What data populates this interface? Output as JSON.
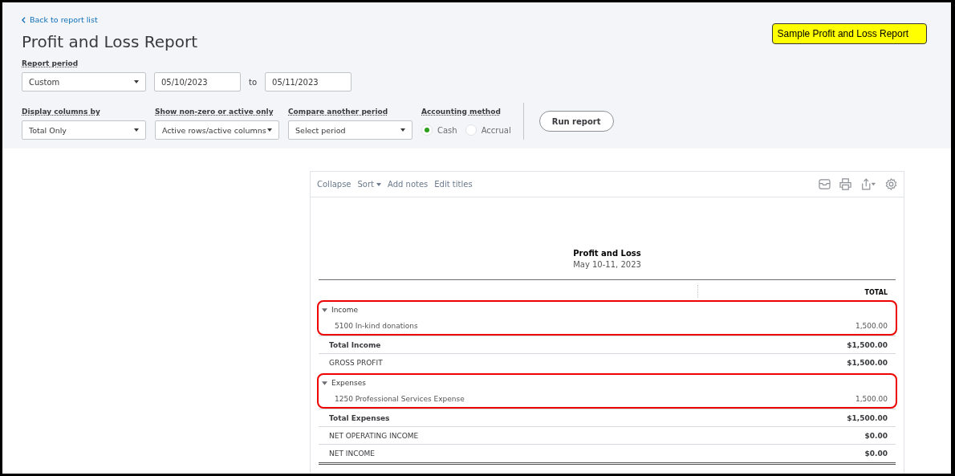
{
  "back_link": "Back to report list",
  "title": "Profit and Loss Report",
  "note": "Sample Profit and Loss Report",
  "report_period": {
    "label": "Report period",
    "preset": "Custom",
    "from": "05/10/2023",
    "to_label": "to",
    "to": "05/11/2023"
  },
  "filters": [
    {
      "label": "Display columns by",
      "value": "Total Only"
    },
    {
      "label": "Show non-zero or active only",
      "value": "Active rows/active columns"
    },
    {
      "label": "Compare another period",
      "placeholder": "Select period"
    }
  ],
  "accounting_method": {
    "label": "Accounting method",
    "options": [
      {
        "label": "Cash",
        "selected": true
      },
      {
        "label": "Accrual",
        "selected": false
      }
    ]
  },
  "run_button": "Run report",
  "toolbar": {
    "actions": [
      {
        "label": "Collapse",
        "dropdown": false
      },
      {
        "label": "Sort",
        "dropdown": true
      },
      {
        "label": "Add notes",
        "dropdown": false
      },
      {
        "label": "Edit titles",
        "dropdown": false
      }
    ]
  },
  "report": {
    "title": "Profit and Loss",
    "period": "May 10-11, 2023",
    "column": "TOTAL",
    "rows": [
      {
        "kind": "group",
        "label": "Income",
        "expanded": true,
        "highlighted": true,
        "children": [
          {
            "label": "5100 In-kind donations",
            "amount": "1,500.00"
          }
        ]
      },
      {
        "kind": "total",
        "label": "Total Income",
        "amount": "$1,500.00"
      },
      {
        "kind": "summary",
        "label": "GROSS PROFIT",
        "amount": "$1,500.00"
      },
      {
        "kind": "group",
        "label": "Expenses",
        "expanded": true,
        "highlighted": true,
        "children": [
          {
            "label": "1250 Professional Services Expense",
            "amount": "1,500.00"
          }
        ]
      },
      {
        "kind": "total",
        "label": "Total Expenses",
        "amount": "$1,500.00"
      },
      {
        "kind": "summary",
        "label": "NET OPERATING INCOME",
        "amount": "$0.00"
      },
      {
        "kind": "summary",
        "label": "NET INCOME",
        "amount": "$0.00"
      }
    ]
  }
}
